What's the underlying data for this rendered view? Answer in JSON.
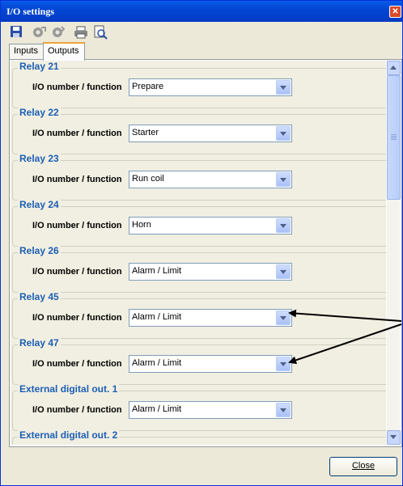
{
  "window": {
    "title": "I/O settings"
  },
  "toolbar": {
    "buttons": [
      {
        "icon": "save-icon"
      },
      {
        "icon": "import-icon"
      },
      {
        "icon": "export-icon"
      },
      {
        "icon": "print-icon"
      },
      {
        "icon": "print-preview-icon"
      }
    ]
  },
  "tabs": [
    {
      "label": "Inputs",
      "active": false
    },
    {
      "label": "Outputs",
      "active": true
    }
  ],
  "groups": [
    {
      "title": "Relay 21",
      "field_label": "I/O number / function",
      "value": "Prepare"
    },
    {
      "title": "Relay 22",
      "field_label": "I/O number / function",
      "value": "Starter"
    },
    {
      "title": "Relay 23",
      "field_label": "I/O number / function",
      "value": "Run coil"
    },
    {
      "title": "Relay 24",
      "field_label": "I/O number / function",
      "value": "Horn"
    },
    {
      "title": "Relay 26",
      "field_label": "I/O number / function",
      "value": "Alarm / Limit"
    },
    {
      "title": "Relay 45",
      "field_label": "I/O number / function",
      "value": "Alarm / Limit"
    },
    {
      "title": "Relay 47",
      "field_label": "I/O number / function",
      "value": "Alarm / Limit"
    },
    {
      "title": "External digital out. 1",
      "field_label": "I/O number / function",
      "value": "Alarm / Limit"
    },
    {
      "title": "External digital out. 2"
    }
  ],
  "footer": {
    "close_label": "Close"
  },
  "colors": {
    "group_title": "#1c5fb4",
    "titlebar": "#0246d3"
  }
}
